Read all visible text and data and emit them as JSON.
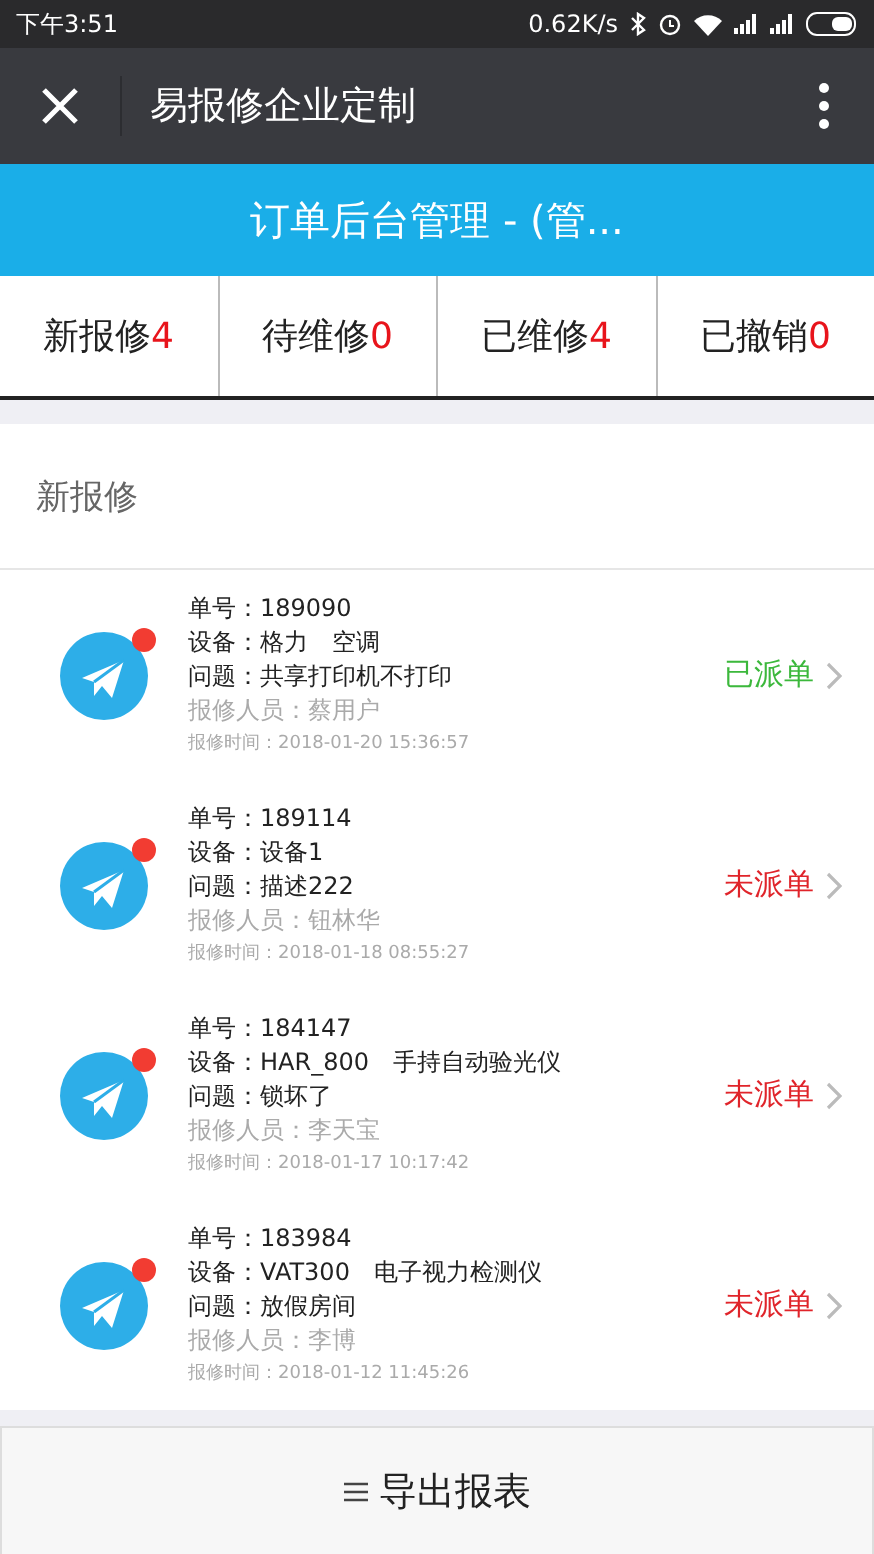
{
  "status_bar": {
    "time": "下午3:51",
    "speed": "0.62K/s"
  },
  "title_bar": {
    "title": "易报修企业定制"
  },
  "banner": {
    "title": "订单后台管理 - (管..."
  },
  "tabs": [
    {
      "label": "新报修",
      "count": "4"
    },
    {
      "label": "待维修",
      "count": "0"
    },
    {
      "label": "已维修",
      "count": "4"
    },
    {
      "label": "已撤销",
      "count": "0"
    }
  ],
  "section": {
    "title": "新报修"
  },
  "orders": [
    {
      "number": "单号：189090",
      "device": "设备：格力　空调",
      "problem": "问题：共享打印机不打印",
      "reporter": "报修人员：蔡用户",
      "time": "报修时间：2018-01-20 15:36:57",
      "status": "已派单",
      "dispatched": true,
      "unread": true
    },
    {
      "number": "单号：189114",
      "device": "设备：设备1",
      "problem": "问题：描述222",
      "reporter": "报修人员：钮林华",
      "time": "报修时间：2018-01-18 08:55:27",
      "status": "未派单",
      "dispatched": false,
      "unread": true
    },
    {
      "number": "单号：184147",
      "device": "设备：HAR_800　手持自动验光仪",
      "problem": "问题：锁坏了",
      "reporter": "报修人员：李天宝",
      "time": "报修时间：2018-01-17 10:17:42",
      "status": "未派单",
      "dispatched": false,
      "unread": true
    },
    {
      "number": "单号：183984",
      "device": "设备：VAT300　电子视力检测仪",
      "problem": "问题：放假房间",
      "reporter": "报修人员：李博",
      "time": "报修时间：2018-01-12 11:45:26",
      "status": "未派单",
      "dispatched": false,
      "unread": true
    }
  ],
  "footer": {
    "button": "导出报表"
  }
}
